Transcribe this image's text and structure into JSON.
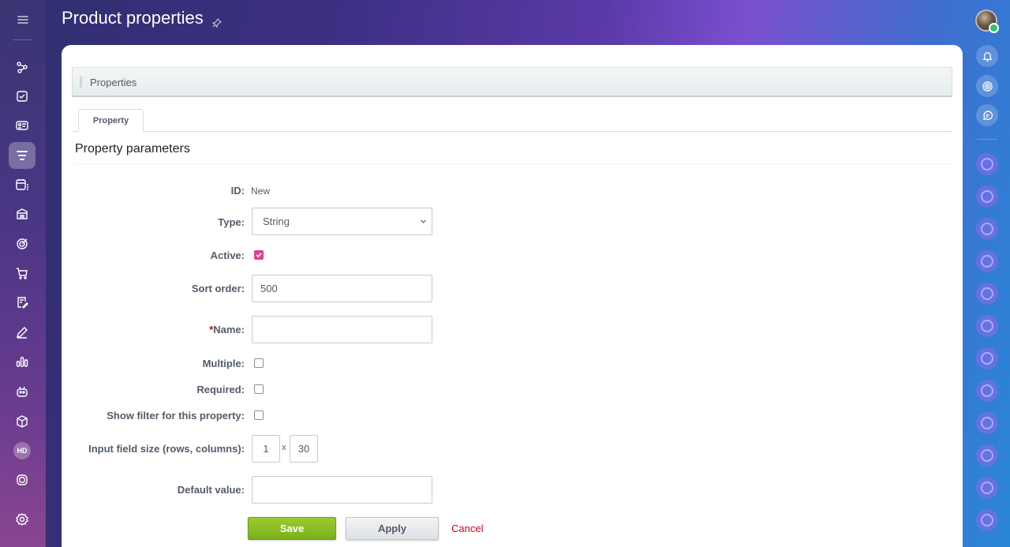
{
  "title": "Product properties",
  "section": {
    "label": "Properties"
  },
  "tabs": [
    {
      "label": "Property"
    }
  ],
  "params_title": "Property parameters",
  "form": {
    "id": {
      "label": "ID:",
      "value": "New"
    },
    "type": {
      "label": "Type:",
      "value": "String"
    },
    "active": {
      "label": "Active:",
      "checked": true
    },
    "sort_order": {
      "label": "Sort order:",
      "value": "500"
    },
    "name": {
      "required_mark": "*",
      "label": "Name:",
      "value": ""
    },
    "multiple": {
      "label": "Multiple:",
      "checked": false
    },
    "required": {
      "label": "Required:",
      "checked": false
    },
    "show_filter": {
      "label": "Show filter for this property:",
      "checked": false
    },
    "input_size": {
      "label": "Input field size (rows, columns):",
      "rows": "1",
      "separator": "x",
      "columns": "30"
    },
    "default_value": {
      "label": "Default value:",
      "value": ""
    }
  },
  "buttons": {
    "save": "Save",
    "apply": "Apply",
    "cancel": "Cancel"
  },
  "sidebar": {
    "hd_badge": "HD",
    "icons": [
      "menu-icon",
      "crm-icon",
      "tasks-icon",
      "contact-card-icon",
      "filter-icon",
      "calendar-icon",
      "store-icon",
      "target-icon",
      "cart-icon",
      "document-edit-icon",
      "pen-icon",
      "chart-icon",
      "robot-icon",
      "box-icon",
      "hd-badge",
      "chat-bot-icon",
      "settings-icon"
    ]
  },
  "right_bar": {
    "icons": [
      "avatar",
      "bell-icon",
      "copilot-icon",
      "chat-icon"
    ]
  },
  "colors": {
    "accent_pink": "#e83e8c",
    "save_green": "#86bd22",
    "cancel_red": "#d0021b"
  }
}
